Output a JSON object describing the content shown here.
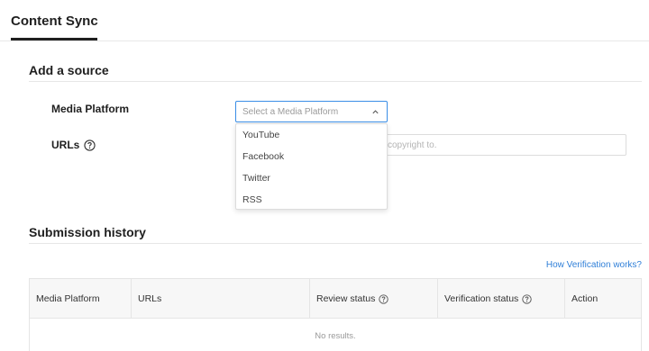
{
  "tabs": {
    "active_label": "Content Sync"
  },
  "add_source": {
    "title": "Add a source",
    "media_platform_label": "Media Platform",
    "urls_label": "URLs",
    "select_placeholder": "Select a Media Platform",
    "url_placeholder_visible": "copyright to.",
    "dropdown_options": [
      "YouTube",
      "Facebook",
      "Twitter",
      "RSS"
    ]
  },
  "submission_history": {
    "title": "Submission history",
    "verification_link": "How Verification works?",
    "columns": [
      "Media Platform",
      "URLs",
      "Review status",
      "Verification status",
      "Action"
    ],
    "empty_text": "No results."
  },
  "icons": {
    "help": "help-circle-icon",
    "chevron": "chevron-up-icon"
  },
  "colors": {
    "accent": "#3a8ee6",
    "link": "#2f7fd8"
  }
}
